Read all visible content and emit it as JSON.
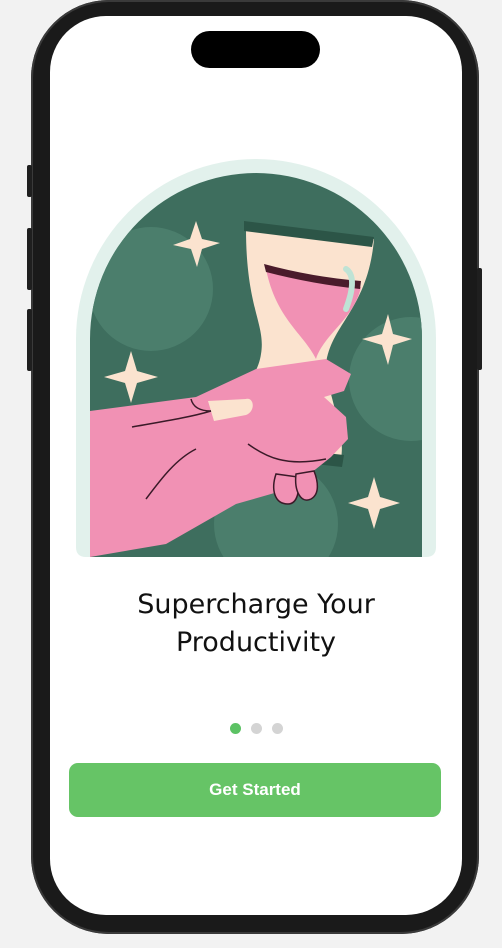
{
  "onboarding": {
    "title_line1": "Supercharge Your",
    "title_line2": "Productivity",
    "cta_label": "Get Started",
    "page_count": 3,
    "active_page": 1
  },
  "colors": {
    "accent": "#66c466",
    "dot_active": "#5cc264",
    "dot_inactive": "#d4d4d4",
    "illustration_bg": "#3e6e5e",
    "illustration_border": "#e2f1ec",
    "hand": "#f191b4",
    "cream": "#fbe3cf"
  },
  "illustration": {
    "subject": "hand holding hourglass with sparkles",
    "icon": "hourglass-icon"
  }
}
